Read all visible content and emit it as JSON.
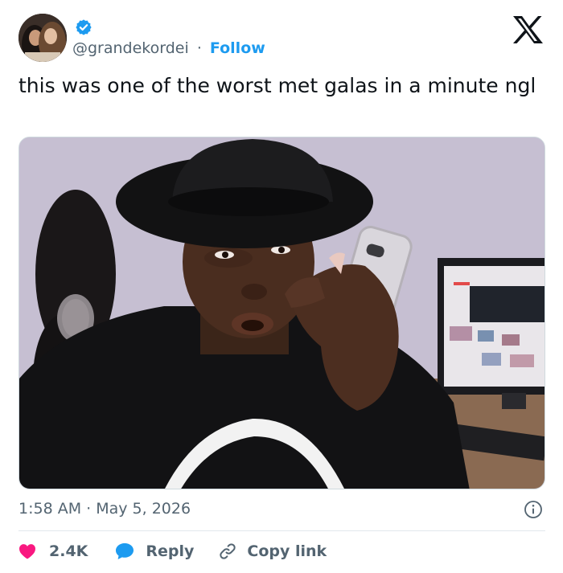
{
  "tweet": {
    "handle": "@grandekordei",
    "separator": "·",
    "follow_label": "Follow",
    "text": "this was one of the worst met galas in a minute ngl",
    "timestamp": "1:58 AM · May 5, 2026"
  },
  "actions": {
    "like_count": "2.4K",
    "reply_label": "Reply",
    "copy_link_label": "Copy link"
  },
  "icons": {
    "verified": "verified-badge-icon",
    "logo": "x-logo-icon",
    "info": "info-icon",
    "like": "heart-icon",
    "reply": "speech-bubble-icon",
    "copy": "link-icon"
  },
  "colors": {
    "accent": "#1d9bf0",
    "like": "#f91880",
    "muted": "#536471",
    "text": "#0f1419"
  }
}
